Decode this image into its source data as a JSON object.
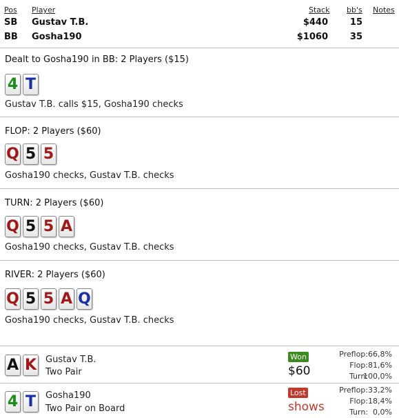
{
  "header": {
    "col_pos": "Pos",
    "col_player": "Player",
    "col_stack": "Stack",
    "col_bbs": "bb's",
    "col_notes": "Notes",
    "players": [
      {
        "pos": "SB",
        "name": "Gustav T.B.",
        "stack": "$440",
        "bbs": "15"
      },
      {
        "pos": "BB",
        "name": "Gosha190",
        "stack": "$1060",
        "bbs": "35"
      }
    ]
  },
  "preflop": {
    "title": "Dealt to Gosha190 in BB: 2 Players ($15)",
    "cards": [
      {
        "rank": "4",
        "color": "#1a8f1a"
      },
      {
        "rank": "T",
        "color": "#1a2fa8"
      }
    ],
    "action": "Gustav T.B. calls $15, Gosha190 checks"
  },
  "flop": {
    "title": "FLOP: 2 Players ($60)",
    "cards": [
      {
        "rank": "Q",
        "color": "#a01818"
      },
      {
        "rank": "5",
        "color": "#111111"
      },
      {
        "rank": "5",
        "color": "#a01818"
      }
    ],
    "action": "Gosha190 checks, Gustav T.B. checks"
  },
  "turn": {
    "title": "TURN: 2 Players ($60)",
    "cards": [
      {
        "rank": "Q",
        "color": "#a01818"
      },
      {
        "rank": "5",
        "color": "#111111"
      },
      {
        "rank": "5",
        "color": "#a01818"
      },
      {
        "rank": "A",
        "color": "#a01818"
      }
    ],
    "action": "Gosha190 checks, Gustav T.B. checks"
  },
  "river": {
    "title": "RIVER: 2 Players ($60)",
    "cards": [
      {
        "rank": "Q",
        "color": "#a01818"
      },
      {
        "rank": "5",
        "color": "#111111"
      },
      {
        "rank": "5",
        "color": "#a01818"
      },
      {
        "rank": "A",
        "color": "#a01818"
      },
      {
        "rank": "Q",
        "color": "#1a2fa8"
      }
    ],
    "action": "Gosha190 checks, Gustav T.B. checks"
  },
  "showdown": [
    {
      "cards": [
        {
          "rank": "A",
          "color": "#111111"
        },
        {
          "rank": "K",
          "color": "#a01818"
        }
      ],
      "name": "Gustav T.B.",
      "hand": "Two Pair",
      "badge": "Won",
      "badge_color": "#3a8a1e",
      "amount": "$60",
      "amount_color": "#111111",
      "equity": [
        {
          "label": "Preflop:",
          "value": "66,8%"
        },
        {
          "label": "Flop:",
          "value": "81,6%"
        },
        {
          "label": "Turn:",
          "value": "100,0%"
        }
      ]
    },
    {
      "cards": [
        {
          "rank": "4",
          "color": "#1a8f1a"
        },
        {
          "rank": "T",
          "color": "#1a2fa8"
        }
      ],
      "name": "Gosha190",
      "hand": "Two Pair on Board",
      "badge": "Lost",
      "badge_color": "#c0392b",
      "amount": "shows",
      "amount_color": "#c0392b",
      "equity": [
        {
          "label": "Preflop:",
          "value": "33,2%"
        },
        {
          "label": "Flop:",
          "value": "18,4%"
        },
        {
          "label": "Turn:",
          "value": "0,0%"
        }
      ]
    }
  ]
}
